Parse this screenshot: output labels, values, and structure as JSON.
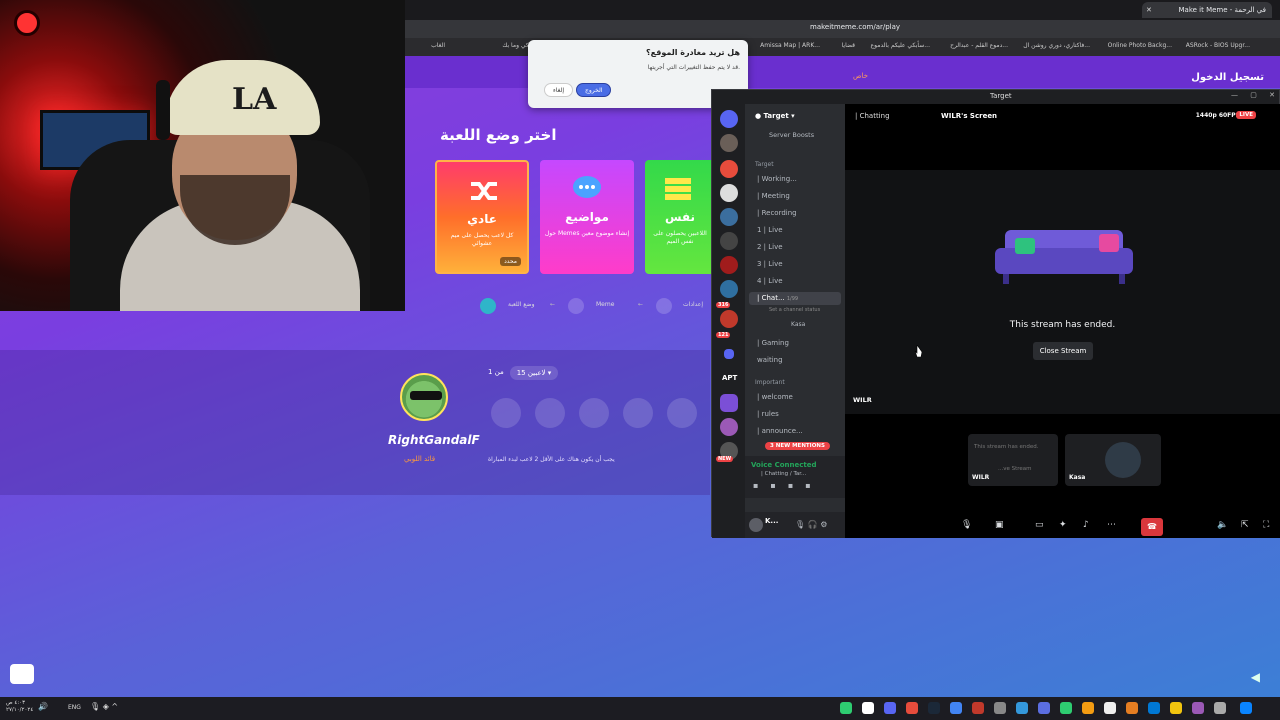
{
  "browser": {
    "active_tab_title": "Make it Meme - في الرحمة",
    "url": "makeitmeme.com/ar/play",
    "bookmarks": [
      "ASRock - BIOS Upgr...",
      "Online Photo Backg...",
      "فاكتاري، دوري روشن ال...",
      "دموع القلم - عبدالرح...",
      "سأبكي عليكم بالدموع...",
      "قضايا",
      "Amissa Map | ARK...",
      "أيها الشاكي وما بك...",
      "الغاب"
    ]
  },
  "site": {
    "login": "تسجيل الدخول",
    "small_label": "خاص",
    "choose_mode": "اختر وضع اللعبة",
    "cards": [
      {
        "title": "عادي",
        "desc": "كل لاعب يحصل على ميم عشوائي",
        "tag": "محدد"
      },
      {
        "title": "مواضيع",
        "desc": "حول Memes إنشاء موضوع معين"
      },
      {
        "title": "نفس",
        "desc": "اللاعبين يحصلون على نفس الميم"
      }
    ],
    "steps": [
      "إعدادات",
      "Meme",
      "وضع اللعبة"
    ],
    "player": {
      "name": "RightGandalF",
      "role": "قائد اللوبي"
    },
    "players_count": "من 1",
    "players_dropdown": "15 لاعبين",
    "need_note": "يجب أن يكون هناك على الأقل 2 لاعب لبدء المباراة"
  },
  "leave_dialog": {
    "title": "هل تريد مغادرة الموقع؟",
    "subtitle": "قد لا يتم حفظ التغييرات التي أجريتها.",
    "leave": "الخروج",
    "cancel": "إلغاء"
  },
  "webcam": {
    "cap_text": "LA"
  },
  "discord": {
    "window_title": "Target",
    "guild": "Target",
    "boosts": "Server Boosts",
    "category_target": "Target",
    "channels": [
      "| Working...",
      "| Meeting",
      "| Recording",
      "1 | Live",
      "2 | Live",
      "3 | Live",
      "4 | Live"
    ],
    "selected_channel": "| Chat...",
    "selected_count": "1/99",
    "set_status": "Set a channel status",
    "voice_member": "Kasa",
    "more_channels": [
      "| Gaming",
      "waiting"
    ],
    "category_important": "Important",
    "important_channels": [
      "| welcome",
      "| rules",
      "| announce..."
    ],
    "new_mentions": "3 NEW MENTIONS",
    "voice_connected": "Voice Connected",
    "voice_sub": "| Chatting / Tar...",
    "user": "K...",
    "servers": {
      "apt": "APT",
      "badge_316": "316",
      "badge_121": "121",
      "new": "NEW"
    },
    "stage": {
      "channel": "| Chatting",
      "screen": "WILR's Screen",
      "quality": "1440p 60FPS",
      "live": "LIVE",
      "ended": "This stream has ended.",
      "close_stream": "Close Stream",
      "wilr": "WILR",
      "tile_text": "This stream has ended.",
      "tile_sub": "...ve Stream",
      "tile_wilr": "WILR",
      "tile_kasa": "Kasa"
    }
  },
  "taskbar": {
    "lang": "ENG",
    "time": "٤:٠٣ ص",
    "date": "٢٧/١٠/٢٠٢٤"
  },
  "colors": {
    "brand_purple": "#8e3fd8",
    "discord_bg": "#1e1f22",
    "live_red": "#ed4245",
    "voice_green": "#23a55a"
  }
}
